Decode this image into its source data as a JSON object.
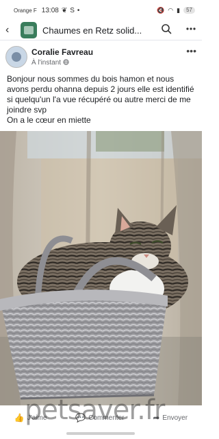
{
  "status_bar": {
    "carrier": "Orange F",
    "time": "13:08",
    "indicator_s": "S",
    "indicator_dot": "•",
    "battery": "57"
  },
  "app_bar": {
    "title": "Chaumes en Retz solid..."
  },
  "post": {
    "author": "Coralie Favreau",
    "time": "À l'instant",
    "paragraphs": [
      "Bonjour nous sommes du bois hamon et nous avons perdu ohanna depuis 2 jours elle est identifié si quelqu'un l'a vue récupéré ou autre merci de me joindre svp",
      "On a le cœur en miette"
    ]
  },
  "actions": {
    "like": "J'aime",
    "comment": "Commenter",
    "share": "Envoyer"
  },
  "watermark": "petsaver.fr",
  "colors": {
    "text": "#1c1e21",
    "secondary": "#65676b"
  }
}
